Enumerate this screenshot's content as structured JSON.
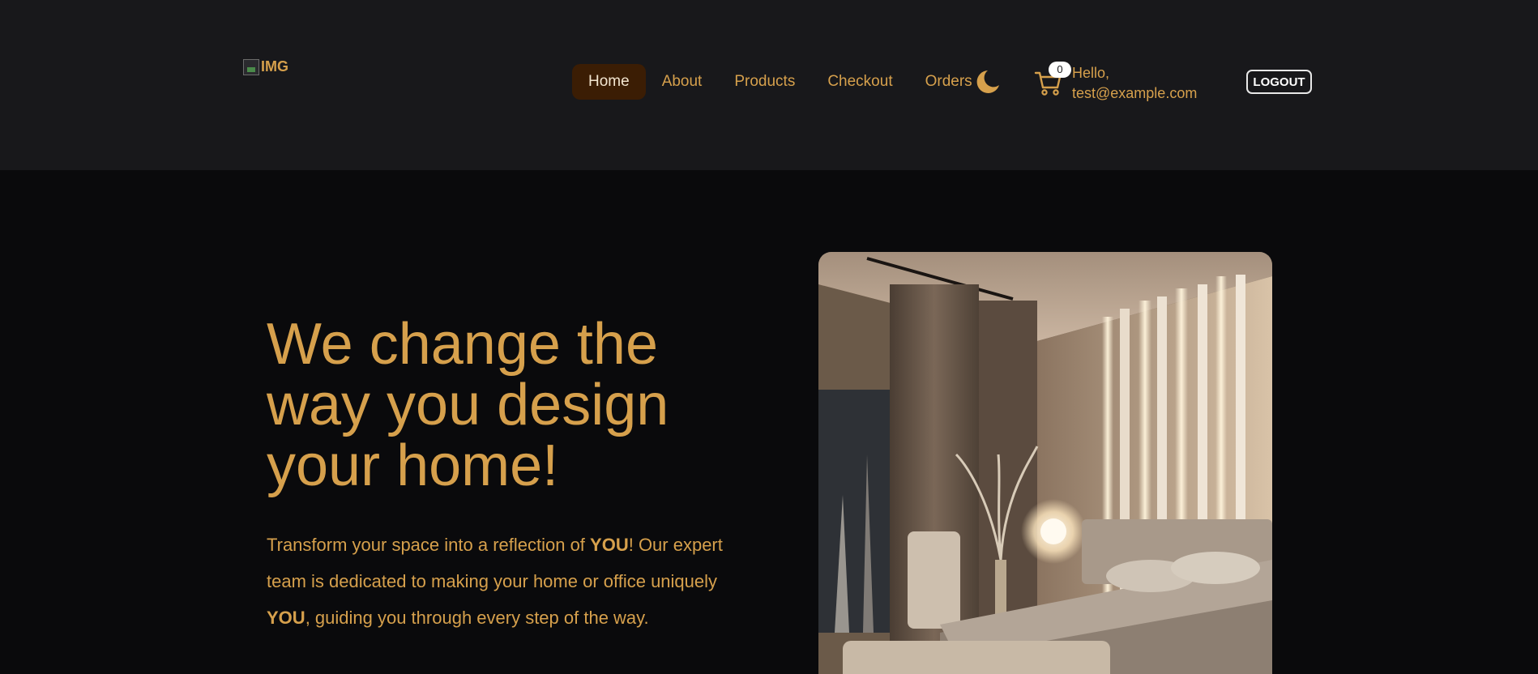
{
  "navbar": {
    "logo_alt": "IMG",
    "links": [
      {
        "label": "Home",
        "active": true
      },
      {
        "label": "About",
        "active": false
      },
      {
        "label": "Products",
        "active": false
      },
      {
        "label": "Checkout",
        "active": false
      },
      {
        "label": "Orders",
        "active": false
      }
    ],
    "theme_icon": "moon-icon",
    "cart_icon": "cart-icon",
    "cart_count": "0",
    "greeting_line1": "Hello,",
    "greeting_line2": "test@example.com",
    "logout_label": "LOGOUT"
  },
  "hero": {
    "title": "We change the way you design your home!",
    "text_part1": "Transform your space into a reflection of ",
    "text_emph1": "YOU",
    "text_part2": "! Our expert team is dedicated to making your home or office uniquely ",
    "text_emph2": "YOU",
    "text_part3": ", guiding you through every step of the way.",
    "image_subject": "bedroom-interior-image"
  },
  "colors": {
    "accent": "#d6a04c",
    "navbar_bg": "#18181b",
    "page_bg": "#0a0a0c",
    "active_link_bg": "#3b1d04"
  }
}
